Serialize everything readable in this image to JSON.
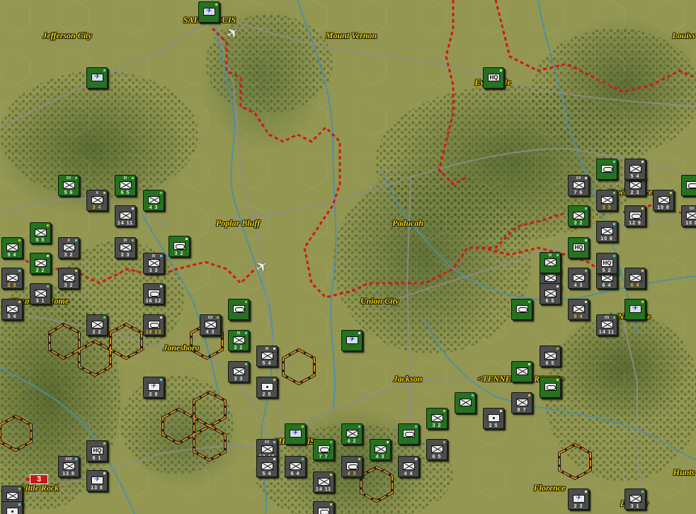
{
  "cities": [
    {
      "name": "SAINT LOUIS"
    },
    {
      "name": "Jefferson City"
    },
    {
      "name": "Mount Vernon"
    },
    {
      "name": "Louisv"
    },
    {
      "name": "Evansville"
    },
    {
      "name": "Bowling Green"
    },
    {
      "name": "Poplar Bluff"
    },
    {
      "name": "Paducah"
    },
    {
      "name": "Mountain Home"
    },
    {
      "name": "Union City"
    },
    {
      "name": "Nashville"
    },
    {
      "name": "Jonesboro"
    },
    {
      "name": "Jackson"
    },
    {
      "name": "<TENNESSEE RIVER>"
    },
    {
      "name": "MEMPHIS"
    },
    {
      "name": "Little Rock"
    },
    {
      "name": "Florence"
    },
    {
      "name": "Decatur"
    },
    {
      "name": "Hunts"
    }
  ],
  "units": [
    {
      "side": "green",
      "kind": "avn",
      "num": ""
    },
    {
      "side": "green",
      "kind": "avn",
      "num": ""
    },
    {
      "side": "green",
      "kind": "hq",
      "num": ""
    },
    {
      "side": "green",
      "kind": "inf",
      "size": "XX",
      "num": "5 6"
    },
    {
      "side": "grey",
      "kind": "inf",
      "size": "X",
      "num": "3 4"
    },
    {
      "side": "green",
      "kind": "inf",
      "size": "III",
      "num": "6 5"
    },
    {
      "side": "grey",
      "kind": "inf",
      "size": "",
      "num": "14 11"
    },
    {
      "side": "green",
      "kind": "inf",
      "num": "4 3"
    },
    {
      "side": "green",
      "kind": "inf",
      "size": "",
      "num": "6 5"
    },
    {
      "side": "grey",
      "kind": "inf",
      "size": "X",
      "num": "3 2"
    },
    {
      "side": "green",
      "kind": "arm",
      "num": "3 2"
    },
    {
      "side": "grey",
      "kind": "inf",
      "size": "III",
      "num": "3 3"
    },
    {
      "side": "green",
      "kind": "inf",
      "num": "9 4"
    },
    {
      "side": "grey",
      "kind": "inf",
      "num": "2 3"
    },
    {
      "side": "green",
      "kind": "inf",
      "num": "2 2"
    },
    {
      "side": "grey",
      "kind": "inf",
      "num": "3 1"
    },
    {
      "side": "grey",
      "kind": "inf",
      "num": "3 2"
    },
    {
      "side": "grey",
      "kind": "inf",
      "size": "III",
      "num": "3 3"
    },
    {
      "side": "grey",
      "kind": "arm",
      "num": "16 12"
    },
    {
      "side": "grey",
      "kind": "inf",
      "num": "2 2"
    },
    {
      "side": "grey",
      "kind": "inf",
      "num": "5 4"
    },
    {
      "side": "grey",
      "kind": "inf",
      "num": "3 3"
    },
    {
      "side": "grey",
      "kind": "arm",
      "num": "18 13"
    },
    {
      "side": "grey",
      "kind": "inf",
      "size": "XX",
      "num": "4 3"
    },
    {
      "side": "green",
      "kind": "inf",
      "num": "2 2"
    },
    {
      "side": "green",
      "kind": "inf",
      "size": "III",
      "num": "2 2"
    },
    {
      "side": "grey",
      "kind": "inf",
      "size": "III",
      "num": "5 4"
    },
    {
      "side": "grey",
      "kind": "inf",
      "num": "3 3"
    },
    {
      "side": "grey",
      "kind": "art",
      "num": "2 5"
    },
    {
      "side": "grey",
      "kind": "avn",
      "num": "2 8"
    },
    {
      "side": "green",
      "kind": "avn",
      "num": ""
    },
    {
      "side": "green",
      "kind": "arm",
      "num": ""
    },
    {
      "side": "grey",
      "kind": "hq",
      "num": "6 1"
    },
    {
      "side": "grey",
      "kind": "inf",
      "size": "XXX",
      "num": "13 8"
    },
    {
      "side": "grey",
      "kind": "avn",
      "num": "13 8"
    },
    {
      "side": "grey",
      "kind": "inf",
      "num": "3 2"
    },
    {
      "side": "green",
      "kind": "avn",
      "num": ""
    },
    {
      "side": "grey",
      "kind": "inf",
      "size": "XX",
      "num": "12 10"
    },
    {
      "side": "grey",
      "kind": "inf",
      "num": "5 4"
    },
    {
      "side": "green",
      "kind": "arm",
      "num": "7 7"
    },
    {
      "side": "grey",
      "kind": "arm",
      "num": "4 3"
    },
    {
      "side": "green",
      "kind": "inf",
      "num": "4 2"
    },
    {
      "side": "green",
      "kind": "inf",
      "num": "4 3"
    },
    {
      "side": "grey",
      "kind": "inf",
      "num": "6 4"
    },
    {
      "side": "grey",
      "kind": "inf",
      "num": "14 11"
    },
    {
      "side": "green",
      "kind": "arm",
      "num": ""
    },
    {
      "side": "grey",
      "kind": "inf",
      "num": "4 4"
    },
    {
      "side": "grey",
      "kind": "inf",
      "num": "6 5"
    },
    {
      "side": "green",
      "kind": "inf",
      "num": "3 2"
    },
    {
      "side": "green",
      "kind": "inf",
      "num": ""
    },
    {
      "side": "grey",
      "kind": "art",
      "num": "2 5"
    },
    {
      "side": "green",
      "kind": "arm",
      "num": ""
    },
    {
      "side": "grey",
      "kind": "inf",
      "num": "8 7"
    },
    {
      "side": "grey",
      "kind": "inf",
      "size": "XX",
      "num": "12 10"
    },
    {
      "side": "green",
      "kind": "inf",
      "num": ""
    },
    {
      "side": "grey",
      "kind": "inf",
      "num": "6 5"
    },
    {
      "side": "green",
      "kind": "arm",
      "num": ""
    },
    {
      "side": "grey",
      "kind": "inf",
      "num": "2 3"
    },
    {
      "side": "grey",
      "kind": "inf",
      "num": "9 4"
    },
    {
      "side": "grey",
      "kind": "inf",
      "size": "XX",
      "num": "14 11"
    },
    {
      "side": "green",
      "kind": "avn",
      "num": ""
    },
    {
      "side": "green",
      "kind": "inf",
      "size": "III",
      "num": ""
    },
    {
      "side": "grey",
      "kind": "inf",
      "num": "6 5"
    },
    {
      "side": "grey",
      "kind": "inf",
      "num": "4 3"
    },
    {
      "side": "grey",
      "kind": "inf",
      "num": "6 4"
    },
    {
      "side": "green",
      "kind": "arm",
      "num": ""
    },
    {
      "side": "grey",
      "kind": "inf",
      "size": "XX",
      "num": "7 6"
    },
    {
      "side": "grey",
      "kind": "inf",
      "num": "3 3"
    },
    {
      "side": "grey",
      "kind": "inf",
      "size": "",
      "num": "10 8"
    },
    {
      "side": "green",
      "kind": "inf",
      "num": "3 2"
    },
    {
      "side": "green",
      "kind": "hq",
      "num": ""
    },
    {
      "side": "grey",
      "kind": "hq",
      "num": "5 2"
    },
    {
      "side": "grey",
      "kind": "arm",
      "num": "12 9"
    },
    {
      "side": "grey",
      "kind": "inf",
      "num": "10 8"
    },
    {
      "side": "grey",
      "kind": "inf",
      "size": "XX",
      "num": "10 8"
    },
    {
      "side": "green",
      "kind": "arm",
      "num": ""
    },
    {
      "side": "grey",
      "kind": "inf",
      "num": "6 4"
    },
    {
      "side": "grey",
      "kind": "inf",
      "num": "2 3"
    },
    {
      "side": "grey",
      "kind": "avn",
      "num": "2 3"
    },
    {
      "side": "grey",
      "kind": "inf",
      "num": "3 1"
    },
    {
      "side": "grey",
      "kind": "arm",
      "num": ""
    },
    {
      "side": "grey",
      "kind": "art",
      "num": ""
    },
    {
      "side": "grey",
      "kind": "inf",
      "num": "5 4"
    }
  ],
  "badge": {
    "label": "3"
  },
  "colors": {
    "friendly": "#25721f",
    "enemy": "#4d4d4d",
    "front_line": "#d01818",
    "zoc_hex": "#e08a1a",
    "city_label": "#f2d21a"
  }
}
